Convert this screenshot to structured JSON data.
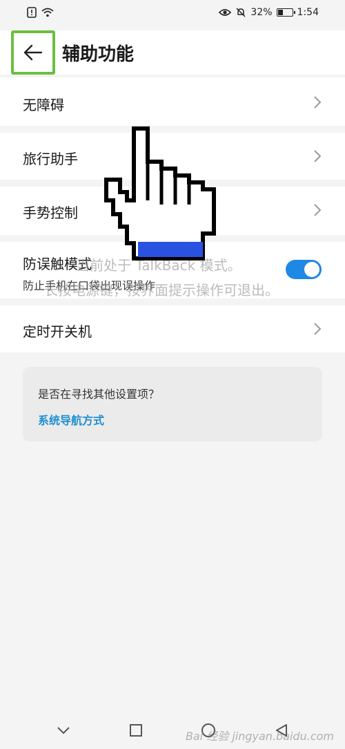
{
  "status": {
    "battery": "32%",
    "time": "1:54",
    "battery_level": 0.32
  },
  "header": {
    "title": "辅助功能"
  },
  "items": [
    {
      "label": "无障碍"
    },
    {
      "label": "旅行助手"
    },
    {
      "label": "手势控制"
    },
    {
      "label": "防误触模式",
      "subtitle": "防止手机在口袋出现误操作",
      "toggle_on": true
    },
    {
      "label": "定时开关机"
    }
  ],
  "suggestion": {
    "question": "是否在寻找其他设置项？",
    "link": "系统导航方式"
  },
  "overlay": {
    "line1": "当前处于 TalkBack 模式。",
    "line2": "长按电源键，按界面提示操作可退出。"
  },
  "watermark": "Bai 经验 jingyan.baidu.com",
  "icons": [
    "back-arrow-icon",
    "chevron-right-icon",
    "pointing-hand-cursor-icon",
    "nav-back-icon",
    "nav-home-icon",
    "nav-recent-icon",
    "nav-collapse-icon"
  ],
  "colors": {
    "accent": "#1e88e5",
    "link": "#1e8fd0",
    "highlight": "#6abf3f"
  }
}
